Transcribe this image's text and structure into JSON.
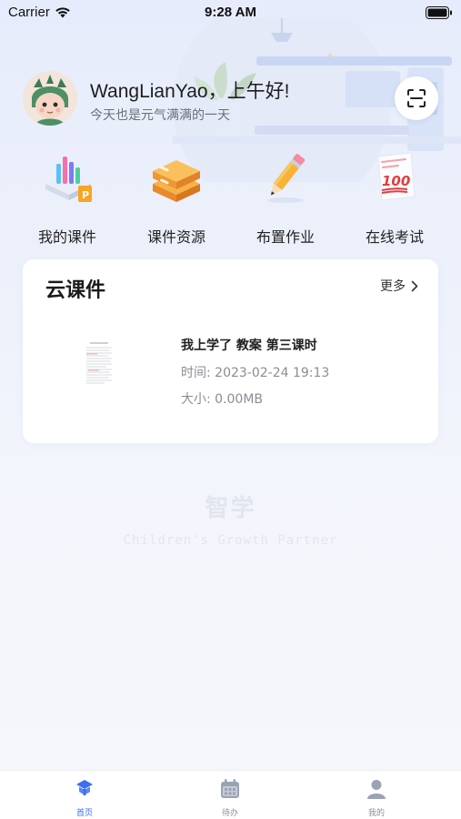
{
  "status_bar": {
    "carrier": "Carrier",
    "time": "9:28 AM"
  },
  "profile": {
    "greeting": "WangLianYao，上午好!",
    "subtitle": "今天也是元气满满的一天",
    "scan_icon": "scan-icon"
  },
  "quick_menu": {
    "items": [
      {
        "label": "我的课件",
        "icon": "chart-courseware-icon"
      },
      {
        "label": "课件资源",
        "icon": "stacked-boxes-icon"
      },
      {
        "label": "布置作业",
        "icon": "pencil-icon"
      },
      {
        "label": "在线考试",
        "icon": "exam-paper-icon"
      }
    ]
  },
  "cloud_card": {
    "title": "云课件",
    "more": "更多",
    "file": {
      "name": "我上学了 教案 第三课时",
      "time": "时间: 2023-02-24 19:13",
      "size": "大小: 0.00MB"
    }
  },
  "watermark": {
    "title": "智学",
    "subtitle": "Children's Growth Partner"
  },
  "tab_bar": {
    "items": [
      {
        "label": "首页",
        "icon": "home-shield-icon",
        "active": true
      },
      {
        "label": "待办",
        "icon": "calendar-icon",
        "active": false
      },
      {
        "label": "我的",
        "icon": "user-icon",
        "active": false
      }
    ]
  },
  "colors": {
    "accent": "#3d6ff0",
    "background": "#eef1fb",
    "card": "#ffffff"
  }
}
